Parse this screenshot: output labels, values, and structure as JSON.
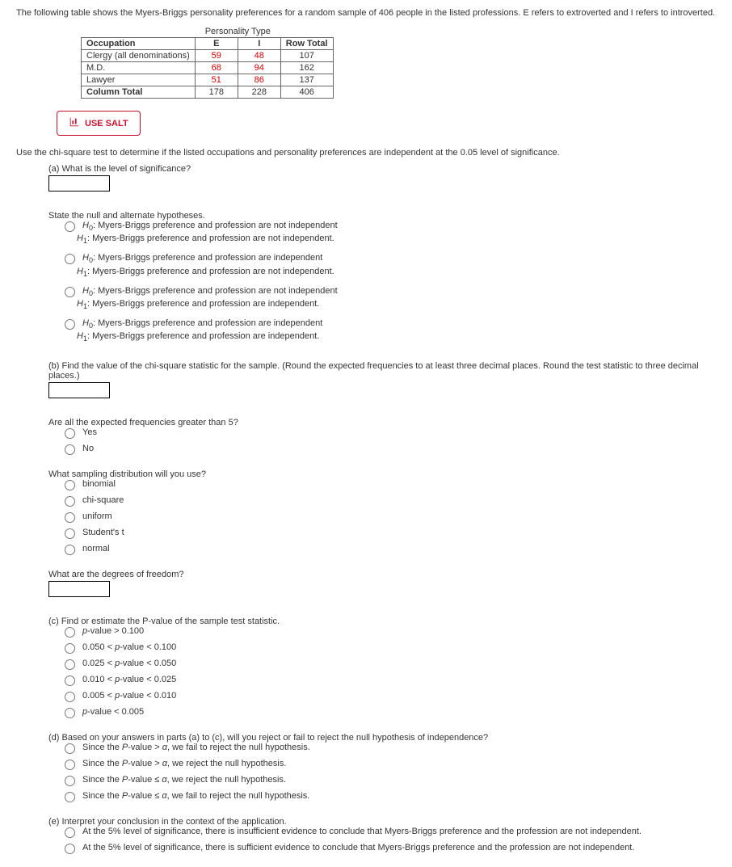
{
  "intro": "The following table shows the Myers-Briggs personality preferences for a random sample of 406 people in the listed professions. E refers to extroverted and I refers to introverted.",
  "table": {
    "group_header": "Personality Type",
    "headers": {
      "occ": "Occupation",
      "e": "E",
      "i": "I",
      "rt": "Row Total"
    },
    "rows": [
      {
        "occ": "Clergy (all denominations)",
        "e": "59",
        "i": "48",
        "rt": "107"
      },
      {
        "occ": "M.D.",
        "e": "68",
        "i": "94",
        "rt": "162"
      },
      {
        "occ": "Lawyer",
        "e": "51",
        "i": "86",
        "rt": "137"
      },
      {
        "occ": "Column Total",
        "e": "178",
        "i": "228",
        "rt": "406"
      }
    ]
  },
  "salt_label": "USE SALT",
  "lead_in": "Use the chi-square test to determine if the listed occupations and personality preferences are independent at the 0.05 level of significance.",
  "qa": "(a) What is the level of significance?",
  "hyp_prompt": "State the null and alternate hypotheses.",
  "h": {
    "o1h0": "Myers-Briggs preference and profession are not independent",
    "o1h1": "Myers-Briggs preference and profession are not independent.",
    "o2h0": "Myers-Briggs preference and profession are independent",
    "o2h1": "Myers-Briggs preference and profession are not independent.",
    "o3h0": "Myers-Briggs preference and profession are not independent",
    "o3h1": "Myers-Briggs preference and profession are independent.",
    "o4h0": "Myers-Briggs preference and profession are independent",
    "o4h1": "Myers-Briggs preference and profession are independent."
  },
  "qb": "(b) Find the value of the chi-square statistic for the sample. (Round the expected frequencies to at least three decimal places. Round the test statistic to three decimal places.)",
  "ef_prompt": "Are all the expected frequencies greater than 5?",
  "ef": {
    "yes": "Yes",
    "no": "No"
  },
  "dist_prompt": "What sampling distribution will you use?",
  "dist": {
    "b": "binomial",
    "c": "chi-square",
    "u": "uniform",
    "s": "Student's t",
    "n": "normal"
  },
  "df_prompt": "What are the degrees of freedom?",
  "qc": "(c) Find or estimate the P-value of the sample test statistic.",
  "pv": {
    "p1": "p-value > 0.100",
    "p2": "0.050 < p-value < 0.100",
    "p3": "0.025 < p-value < 0.050",
    "p4": "0.010 < p-value < 0.025",
    "p5": "0.005 < p-value < 0.010",
    "p6": "p-value < 0.005"
  },
  "qd": "(d) Based on your answers in parts (a) to (c), will you reject or fail to reject the null hypothesis of independence?",
  "dec": {
    "d1": "Since the P-value > α, we fail to reject the null hypothesis.",
    "d2": "Since the P-value > α, we reject the null hypothesis.",
    "d3": "Since the P-value ≤ α, we reject the null hypothesis.",
    "d4": "Since the P-value ≤ α, we fail to reject the null hypothesis."
  },
  "qe": "(e) Interpret your conclusion in the context of the application.",
  "con": {
    "c1": "At the 5% level of significance, there is insufficient evidence to conclude that Myers-Briggs preference and the profession are not independent.",
    "c2": "At the 5% level of significance, there is sufficient evidence to conclude that Myers-Briggs preference and the profession are not independent."
  }
}
